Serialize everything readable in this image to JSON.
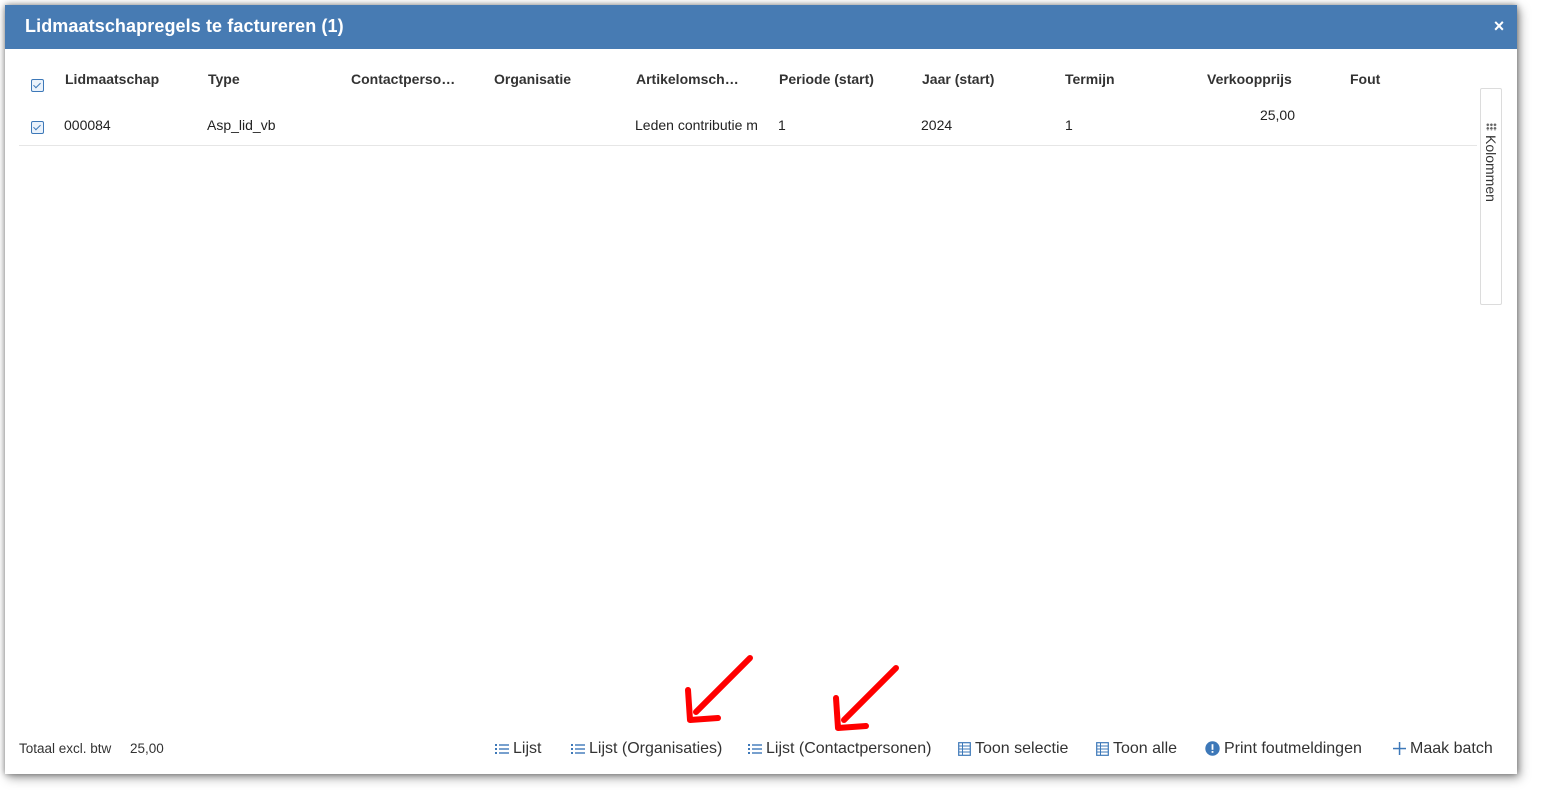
{
  "dialog": {
    "title": "Lidmaatschapregels te factureren (1)",
    "close_symbol": "×"
  },
  "table": {
    "columns": [
      "Lidmaatschap",
      "Type",
      "Contactperso…",
      "Organisatie",
      "Artikelomsch…",
      "Periode (start)",
      "Jaar (start)",
      "Termijn",
      "Verkoopprijs",
      "Fout"
    ],
    "rows": [
      {
        "lidmaatschap": "000084",
        "type": "Asp_lid_vb",
        "contactpersoon": "",
        "organisatie": "",
        "artikelomschrijving": "Leden contributie m",
        "periode": "1",
        "jaar": "2024",
        "termijn": "1",
        "verkoopprijs": "25,00",
        "fout": "",
        "checked": true
      }
    ],
    "select_all_checked": true
  },
  "side_panel": {
    "label": "Kolommen",
    "icon": "grid-dots-icon"
  },
  "footer": {
    "total_label": "Totaal excl. btw",
    "total_value": "25,00",
    "buttons": [
      {
        "label": "Lijst",
        "icon": "list-icon"
      },
      {
        "label": "Lijst (Organisaties)",
        "icon": "list-icon"
      },
      {
        "label": "Lijst (Contactpersonen)",
        "icon": "list-icon"
      },
      {
        "label": "Toon selectie",
        "icon": "table-icon"
      },
      {
        "label": "Toon alle",
        "icon": "table-icon"
      },
      {
        "label": "Print foutmeldingen",
        "icon": "exclamation-circle-icon"
      },
      {
        "label": "Maak batch",
        "icon": "plus-icon"
      }
    ]
  },
  "colors": {
    "titlebar": "#477bb3",
    "accent": "#3d78b8",
    "annotation_arrow": "#ff0000"
  }
}
